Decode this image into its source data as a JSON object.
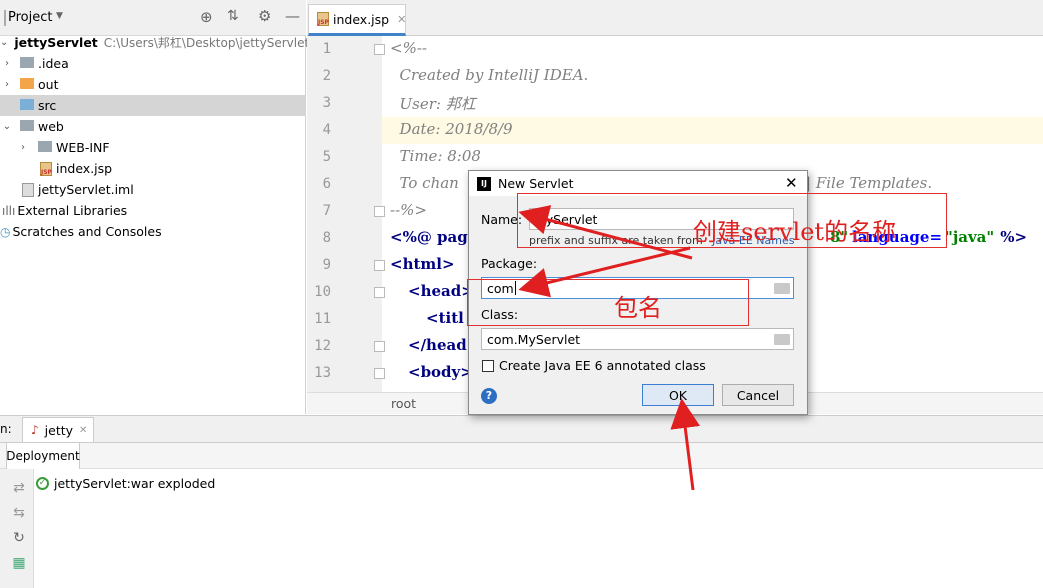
{
  "project": {
    "title": "Project",
    "items": [
      {
        "label": "jettyServlet",
        "path": "C:\\Users\\邦杠\\Desktop\\jettyServlet"
      },
      {
        "label": ".idea"
      },
      {
        "label": "out"
      },
      {
        "label": "src"
      },
      {
        "label": "web"
      },
      {
        "label": "WEB-INF"
      },
      {
        "label": "index.jsp"
      },
      {
        "label": "jettyServlet.iml"
      },
      {
        "label": "External Libraries"
      },
      {
        "label": "Scratches and Consoles"
      }
    ]
  },
  "editor": {
    "tab": "index.jsp",
    "file_icon": "JSP",
    "line_numbers": [
      "1",
      "2",
      "3",
      "4",
      "5",
      "6",
      "7",
      "8",
      "9",
      "10",
      "11",
      "12",
      "13"
    ],
    "lines": {
      "l1": "<%--",
      "l2": "  Created by IntelliJ IDEA.",
      "l3": "  User: 邦杠",
      "l4": "  Date: 2018/8/9",
      "l5": "  Time: 8:08",
      "l6": "  To chan",
      "l6b": "| File Templates.",
      "l7": "--%>",
      "l8a": "<%@ page",
      "l8b": "8\"",
      "l8c": "language=",
      "l8d": "\"java\"",
      "l8e": " %>",
      "l9": "<html>",
      "l10": "<head>",
      "l11": "<titl",
      "l12": "</head",
      "l13": "<body>"
    },
    "breadcrumb": "root"
  },
  "run": {
    "prefix": "n:",
    "tab": "jetty",
    "deployment_tab": "Deployment",
    "item": "jettyServlet:war exploded"
  },
  "dialog": {
    "title": "New Servlet",
    "name_label": "Name:",
    "name_value": "MyServlet",
    "hint": "prefix and suffix are taken from",
    "hint_link": "Java EE Names",
    "package_label": "Package:",
    "package_value": "com",
    "class_label": "Class:",
    "class_value": "com.MyServlet",
    "checkbox_label": "Create Java EE 6 annotated class",
    "checkbox_checked": false,
    "ok": "OK",
    "cancel": "Cancel",
    "help": "?"
  },
  "annotations": {
    "servlet_name": "创建servlet的名称",
    "package_name": "包名"
  },
  "colors": {
    "accent": "#4083c9",
    "annotation": "#e02020"
  }
}
